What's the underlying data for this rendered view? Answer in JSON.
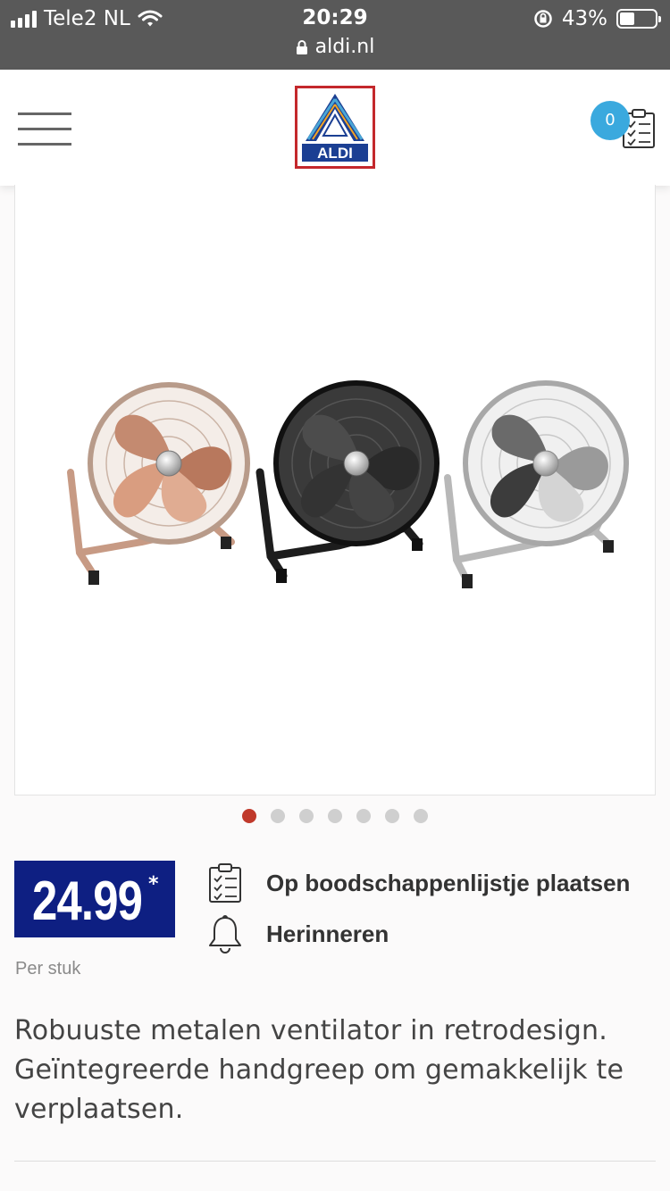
{
  "status_bar": {
    "carrier": "Tele2 NL",
    "time": "20:29",
    "battery": "43%",
    "battery_level": 0.43,
    "url": "aldi.nl"
  },
  "header": {
    "logo_text": "ALDI",
    "list_count": "0",
    "icons": [
      "menu-icon",
      "shopping-list-icon"
    ]
  },
  "carousel": {
    "dot_count": 7,
    "active_index": 0,
    "image_alt": "Three retro metal floor fans: copper, black and chrome"
  },
  "product": {
    "price": "24.99",
    "price_mark": "*",
    "unit": "Per stuk",
    "add_to_list_label": "Op boodschappenlijstje plaatsen",
    "remind_label": "Herinneren",
    "description": "Robuuste metalen ventilator in retrodesign. Geïntegreerde handgreep om gemakkelijk te verplaatsen."
  },
  "colors": {
    "status_bar": "#595959",
    "price_bg": "#0e1f82",
    "badge": "#3aa9de",
    "active_dot": "#c0392b",
    "logo_red": "#c4282c",
    "logo_blue": "#1b3f93"
  }
}
